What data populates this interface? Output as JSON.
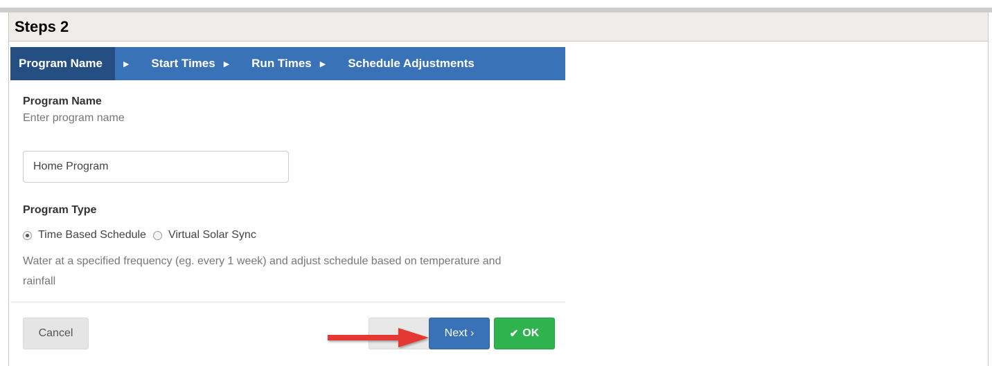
{
  "section": {
    "title": "Steps 2"
  },
  "steps": [
    {
      "label": "Program Name",
      "active": true
    },
    {
      "label": "Start Times",
      "active": false
    },
    {
      "label": "Run Times",
      "active": false
    },
    {
      "label": "Schedule Adjustments",
      "active": false
    }
  ],
  "program_name": {
    "title": "Program Name",
    "hint": "Enter program name",
    "value": "Home Program"
  },
  "program_type": {
    "title": "Program Type",
    "options": [
      {
        "label": "Time Based Schedule",
        "selected": true
      },
      {
        "label": "Virtual Solar Sync",
        "selected": false
      }
    ],
    "description": "Water at a specified frequency (eg. every 1 week) and adjust schedule based on temperature and rainfall"
  },
  "buttons": {
    "cancel": "Cancel",
    "next": "Next ›",
    "ok": "OK"
  },
  "colors": {
    "steps_bar": "#3a72b8",
    "active_step": "#254e82",
    "next_button": "#3a72b8",
    "ok_button": "#2eb34e",
    "annotation_arrow": "#e53935"
  },
  "icons": {
    "step_separator": "caret-right-icon",
    "ok": "check-icon",
    "annotation": "red-arrow-icon"
  }
}
